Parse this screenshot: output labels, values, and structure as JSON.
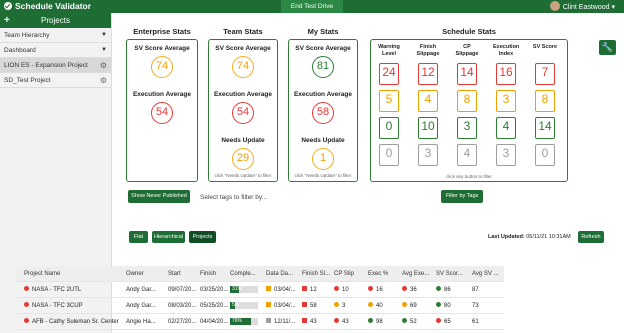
{
  "topbar": {
    "app_title": "Schedule Validator",
    "center_button": "End Test Drive",
    "user_name": "Clint Eastwood"
  },
  "sidebar": {
    "projects_label": "Projects",
    "items": [
      {
        "label": "Team Hierarchy"
      },
      {
        "label": "Dashboard"
      },
      {
        "label": "LION ES - Expansion Project"
      },
      {
        "label": "SD_Test Project"
      }
    ]
  },
  "enterprise": {
    "title": "Enterprise Stats",
    "sv_label": "SV Score Average",
    "sv_value": "74",
    "exec_label": "Execution Average",
    "exec_value": "54"
  },
  "team": {
    "title": "Team Stats",
    "sv_label": "SV Score Average",
    "sv_value": "74",
    "exec_label": "Execution Average",
    "exec_value": "54",
    "needs_label": "Needs Update",
    "needs_value": "29",
    "hint": "click \"Needs Update\" to filter"
  },
  "mystats": {
    "title": "My Stats",
    "sv_label": "SV Score Average",
    "sv_value": "81",
    "exec_label": "Execution Average",
    "exec_value": "58",
    "needs_label": "Needs Update",
    "needs_value": "1",
    "hint": "click \"Needs Update\" to filter"
  },
  "schedule": {
    "title": "Schedule Stats",
    "headers": [
      "Warning Level",
      "Finish Slippage",
      "CP Slippage",
      "Execution Index",
      "SV Score"
    ],
    "rows": [
      {
        "color": "#e53935",
        "values": [
          "24",
          "12",
          "14",
          "16",
          "7"
        ]
      },
      {
        "color": "#f0a000",
        "values": [
          "5",
          "4",
          "8",
          "3",
          "8"
        ]
      },
      {
        "color": "#2e7d32",
        "values": [
          "0",
          "10",
          "3",
          "4",
          "14"
        ]
      },
      {
        "color": "#9e9e9e",
        "values": [
          "0",
          "3",
          "4",
          "3",
          "0"
        ]
      }
    ],
    "hint": "click any button to filter"
  },
  "controls": {
    "show_never_published": "Show Never Published",
    "tag_placeholder": "Select tags to filter by...",
    "filter_by_tags": "Filter by Tags"
  },
  "view": {
    "tabs": [
      "Flat",
      "Hierarchical",
      "Projects"
    ],
    "last_updated_label": "Last Updated:",
    "last_updated_value": "05/11/21 10:31AM",
    "refresh": "Refresh"
  },
  "table": {
    "headers": [
      "Project Name",
      "Owner",
      "Start",
      "Finish",
      "Comple...",
      "Data Da...",
      "Finish Sl...",
      "CP Slip",
      "Exec %",
      "Avg Exe...",
      "SV Scor...",
      "Avg SV ..."
    ],
    "rows": [
      {
        "status": "#e53935",
        "name": "NASA - TFC 2UTL",
        "owner": "Andy Gar...",
        "start": "09/07/20...",
        "finish": "03/25/20...",
        "complete": "31%",
        "complete_pct": 0.31,
        "data_date_color": "#f0a000",
        "data_date": "03/04/...",
        "finish_slip_color": "#e53935",
        "finish_slip": "12",
        "cp_color": "#e53935",
        "cp": "10",
        "exec_color": "#e53935",
        "exec": "16",
        "avg_exec_color": "#e53935",
        "avg_exec": "36",
        "sv_color": "#2e7d32",
        "sv": "86",
        "avg_sv": "87"
      },
      {
        "status": "#e53935",
        "name": "NASA - TFC 3CUP",
        "owner": "Andy Gar...",
        "start": "08/03/20...",
        "finish": "05/25/20...",
        "complete": "5%",
        "complete_pct": 0.05,
        "data_date_color": "#f0a000",
        "data_date": "03/04/...",
        "finish_slip_color": "#e53935",
        "finish_slip": "58",
        "cp_color": "#f0a000",
        "cp": "3",
        "exec_color": "#f0a000",
        "exec": "40",
        "avg_exec_color": "#f0a000",
        "avg_exec": "69",
        "sv_color": "#2e7d32",
        "sv": "80",
        "avg_sv": "73"
      },
      {
        "status": "#e53935",
        "name": "AFB - Cathy Suleman Sr. Center",
        "owner": "Angie Ha...",
        "start": "02/27/20...",
        "finish": "04/04/20...",
        "complete": "76%",
        "complete_pct": 0.76,
        "data_date_color": "#9e9e9e",
        "data_date": "12/11/...",
        "finish_slip_color": "#e53935",
        "finish_slip": "43",
        "cp_color": "#e53935",
        "cp": "43",
        "exec_color": "#2e7d32",
        "exec": "98",
        "avg_exec_color": "#2e7d32",
        "avg_exec": "52",
        "sv_color": "#e53935",
        "sv": "65",
        "avg_sv": "61"
      }
    ]
  }
}
